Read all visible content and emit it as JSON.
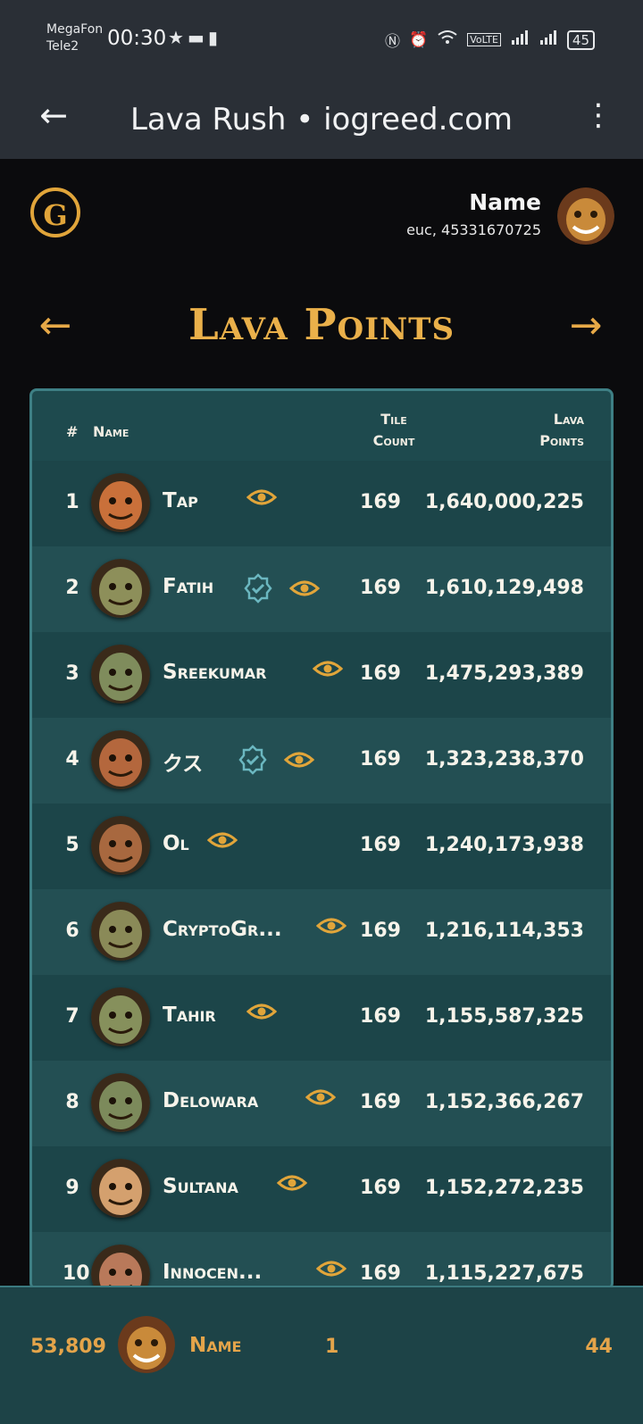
{
  "status_bar": {
    "carrier1": "MegaFon",
    "carrier2": "Tele2",
    "time": "00:30",
    "battery": "45",
    "network": "VoLTE"
  },
  "browser": {
    "title": "Lava Rush • iogreed.com"
  },
  "header": {
    "logo_letter": "G",
    "user_name": "Name",
    "user_id": "euc, 45331670725"
  },
  "section": {
    "title": "Lava Points"
  },
  "table": {
    "columns": {
      "rank": "#",
      "name": "Name",
      "tile_count_1": "Tile",
      "tile_count_2": "Count",
      "points_1": "Lava",
      "points_2": "Points"
    },
    "rows": [
      {
        "rank": "1",
        "name": "Tap",
        "verified": false,
        "tiles": "169",
        "points": "1,640,000,225",
        "skin": "#c9703a"
      },
      {
        "rank": "2",
        "name": "Fatih",
        "verified": true,
        "tiles": "169",
        "points": "1,610,129,498",
        "skin": "#8d8f5a"
      },
      {
        "rank": "3",
        "name": "Sreekumar",
        "verified": false,
        "tiles": "169",
        "points": "1,475,293,389",
        "skin": "#7f8c5c"
      },
      {
        "rank": "4",
        "name": "クス",
        "verified": true,
        "tiles": "169",
        "points": "1,323,238,370",
        "skin": "#b4673d"
      },
      {
        "rank": "5",
        "name": "Ol",
        "verified": false,
        "tiles": "169",
        "points": "1,240,173,938",
        "skin": "#a8683f"
      },
      {
        "rank": "6",
        "name": "CryptoGr...",
        "verified": false,
        "tiles": "169",
        "points": "1,216,114,353",
        "skin": "#8a8a58"
      },
      {
        "rank": "7",
        "name": "Tahir",
        "verified": false,
        "tiles": "169",
        "points": "1,155,587,325",
        "skin": "#86905c"
      },
      {
        "rank": "8",
        "name": "Delowara",
        "verified": false,
        "tiles": "169",
        "points": "1,152,366,267",
        "skin": "#7c8a5b"
      },
      {
        "rank": "9",
        "name": "Sultana",
        "verified": false,
        "tiles": "169",
        "points": "1,152,272,235",
        "skin": "#d4a06e"
      },
      {
        "rank": "10",
        "name": "Innocen...",
        "verified": false,
        "tiles": "169",
        "points": "1,115,227,675",
        "skin": "#b9795a"
      }
    ]
  },
  "footer": {
    "score": "53,809",
    "name": "Name",
    "rank": "1",
    "count": "44"
  },
  "colors": {
    "accent": "#eab04a",
    "table_bg": "#1e4a4e",
    "table_border": "#3e7f84"
  }
}
